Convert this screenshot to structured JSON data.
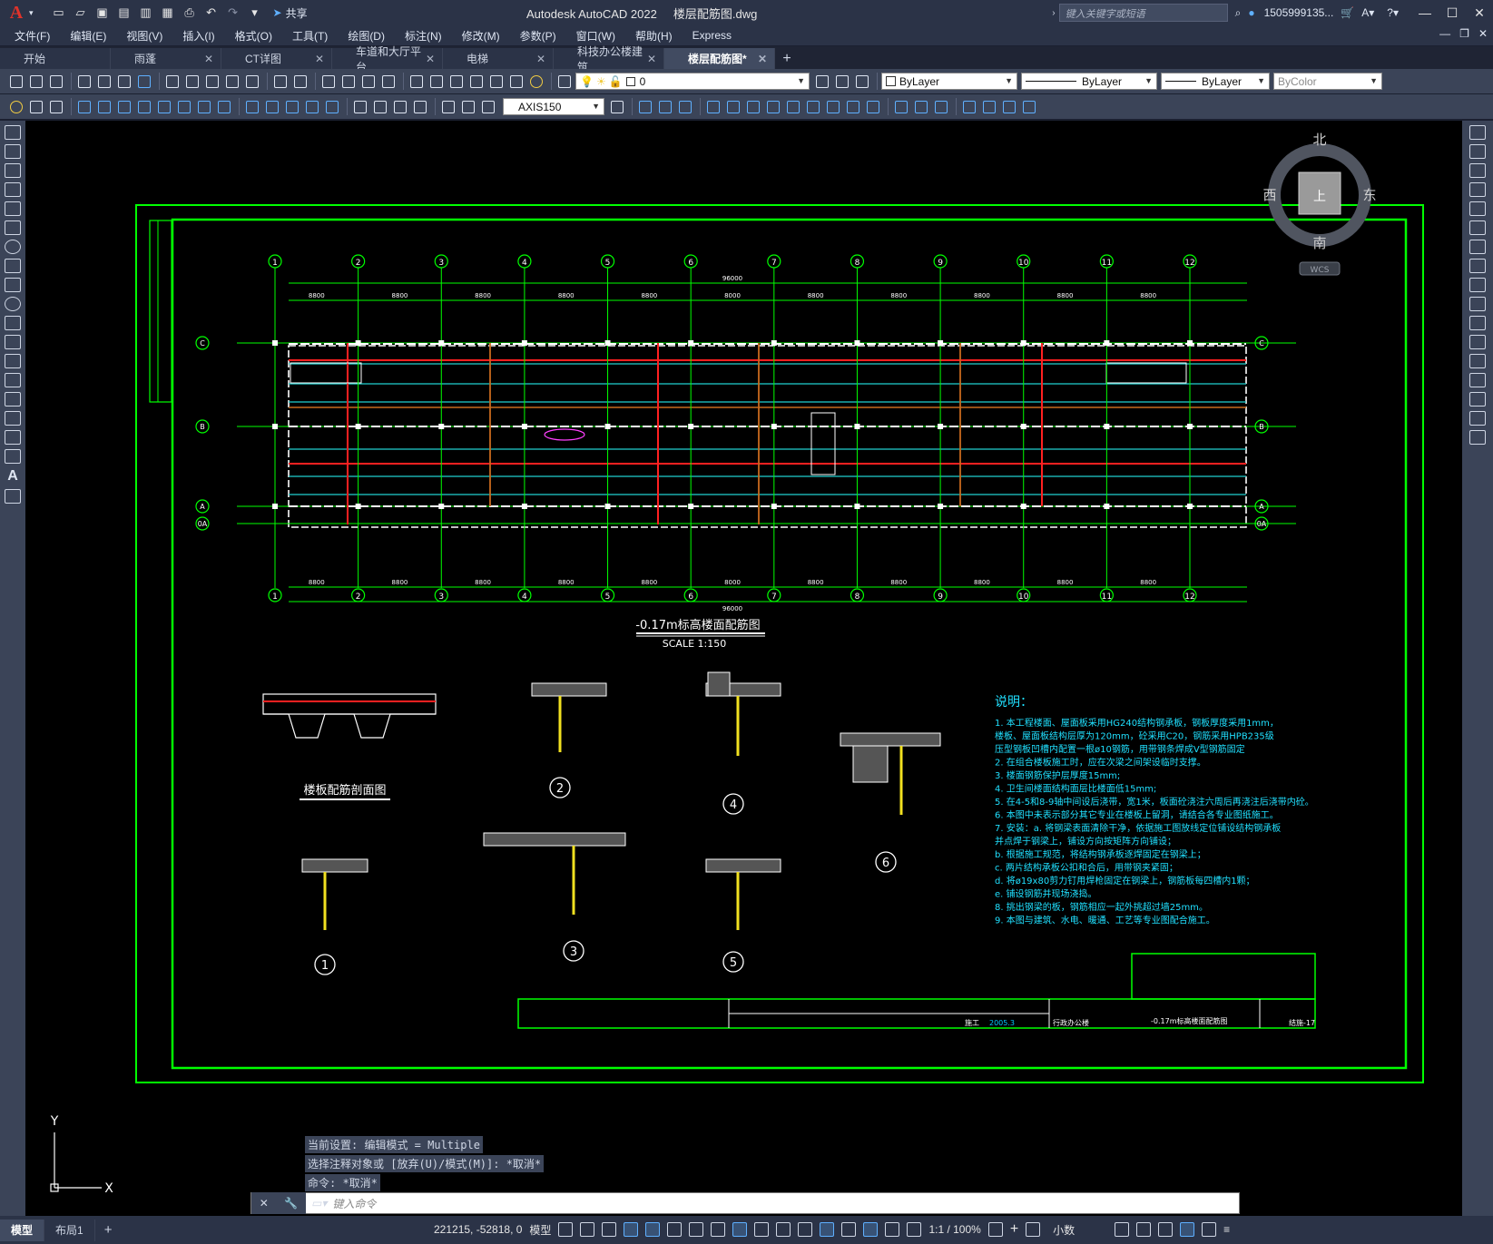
{
  "app": {
    "title": "Autodesk AutoCAD 2022",
    "filename": "楼层配筋图.dwg",
    "logo": "A",
    "share_label": "共享",
    "search_placeholder": "键入关键字或短语",
    "username": "1505999135...",
    "accent_color": "#e0332a"
  },
  "menu": [
    "文件(F)",
    "编辑(E)",
    "视图(V)",
    "插入(I)",
    "格式(O)",
    "工具(T)",
    "绘图(D)",
    "标注(N)",
    "修改(M)",
    "参数(P)",
    "窗口(W)",
    "帮助(H)",
    "Express"
  ],
  "tabs": [
    {
      "label": "开始",
      "active": false
    },
    {
      "label": "雨蓬",
      "active": false
    },
    {
      "label": "CT详图",
      "active": false
    },
    {
      "label": "车道和大厅平台",
      "active": false
    },
    {
      "label": "电梯",
      "active": false
    },
    {
      "label": "科技办公楼建筑",
      "active": false
    },
    {
      "label": "楼层配筋图*",
      "active": true
    }
  ],
  "toolbar": {
    "layer_value": "0",
    "color_value": "ByLayer",
    "linetype_value": "ByLayer",
    "lineweight_value": "ByLayer",
    "plotstyle_value": "ByColor",
    "dimstyle_value": "AXIS150"
  },
  "viewcube": {
    "north": "北",
    "south": "南",
    "east": "东",
    "west": "西",
    "top": "上",
    "wcs": "WCS"
  },
  "drawing": {
    "plan_title": "-0.17m标高楼面配筋图",
    "plan_scale": "SCALE 1:150",
    "section_title": "楼板配筋剖面图",
    "axes": [
      "1",
      "2",
      "3",
      "4",
      "5",
      "6",
      "7",
      "8",
      "9",
      "10",
      "11",
      "12"
    ],
    "row_axes": [
      "C",
      "B",
      "A",
      "0A"
    ],
    "total_dim": "96000",
    "bay_dims": [
      "8800",
      "8800",
      "8800",
      "8800",
      "8800",
      "8000",
      "8800",
      "8800",
      "8800",
      "8800",
      "8800"
    ],
    "detail_numbers": [
      "1",
      "2",
      "3",
      "4",
      "5",
      "6"
    ],
    "notes_title": "说明：",
    "notes": [
      "1. 本工程楼面、屋面板采用HG240结构钢承板，钢板厚度采用1mm，",
      "   楼板、屋面板结构层厚为120mm，砼采用C20，钢筋采用HPB235级",
      "   压型钢板凹槽内配置一根ø10钢筋，用带钢条焊成V型钢筋固定",
      "2. 在组合楼板施工时，应在次梁之间架设临时支撑。",
      "3. 楼面钢筋保护层厚度15mm;",
      "4. 卫生间楼面结构面层比楼面低15mm;",
      "5. 在4-5和8-9轴中间设后浇带，宽1米，板面砼浇注六周后再浇注后浇带内砼。",
      "6. 本图中未表示部分其它专业在楼板上留洞，请结合各专业图纸施工。",
      "7. 安装：a. 将钢梁表面清除干净，依据施工图放线定位铺设结构钢承板",
      "      并点焊于钢梁上，铺设方向按矩阵方向铺设；",
      "   b. 根据施工规范，将结构钢承板逐焊固定在钢梁上；",
      "   c. 两片结构承板公扣和合后，用带钢夹紧固；",
      "   d. 将ø19x80剪力钉用焊枪固定在钢梁上，钢筋板每四槽内1颗；",
      "   e. 铺设钢筋并现场浇捣。",
      "8. 挑出钢梁的板，钢筋相应一起外挑超过墙25mm。",
      "9. 本图与建筑、水电、暖通、工艺等专业图配合施工。"
    ],
    "titleblock": {
      "drawing_name": "-0.17m标高楼面配筋图",
      "sheet_no": "结施-17",
      "project": "行政办公楼",
      "date": "2005.3",
      "phase": "施工"
    }
  },
  "command": {
    "lines": [
      "当前设置: 编辑模式 = Multiple",
      "选择注释对象或 [放弃(U)/模式(M)]: *取消*",
      "命令: *取消*"
    ],
    "placeholder": "键入命令"
  },
  "status": {
    "layout_tabs": [
      {
        "label": "模型",
        "active": true
      },
      {
        "label": "布局1",
        "active": false
      }
    ],
    "coords": "221215, -52818, 0",
    "space": "模型",
    "scale": "1:1 / 100%",
    "units": "小数"
  },
  "ucs": {
    "x_label": "X",
    "y_label": "Y"
  }
}
